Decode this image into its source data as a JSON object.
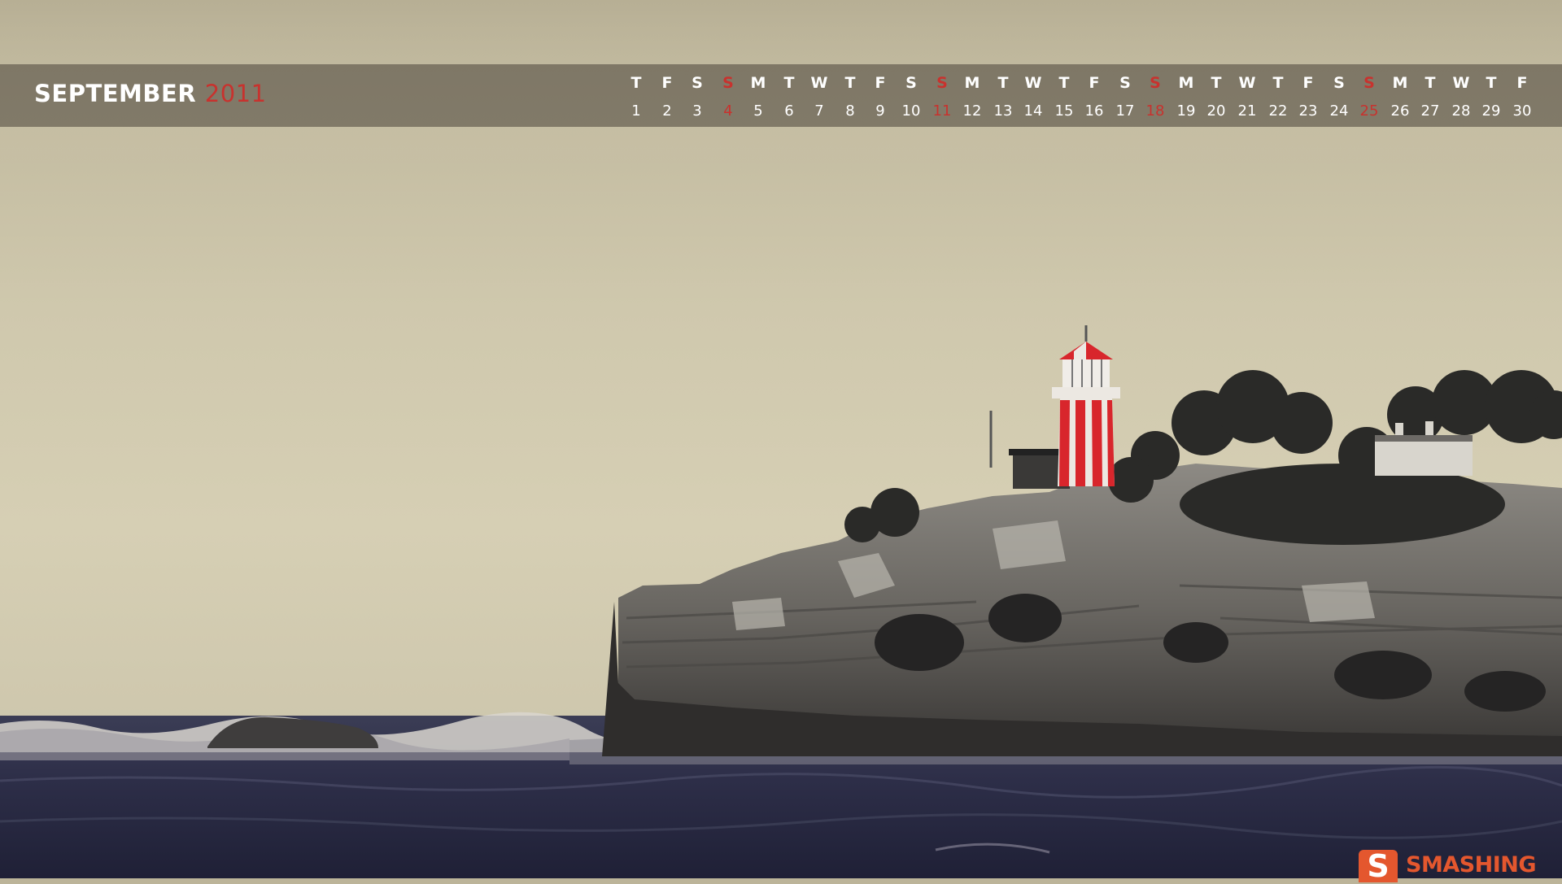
{
  "calendar": {
    "month": "SEPTEMBER",
    "year": "2011",
    "days": [
      {
        "dow": "T",
        "num": "1",
        "sunday": false
      },
      {
        "dow": "F",
        "num": "2",
        "sunday": false
      },
      {
        "dow": "S",
        "num": "3",
        "sunday": false
      },
      {
        "dow": "S",
        "num": "4",
        "sunday": true
      },
      {
        "dow": "M",
        "num": "5",
        "sunday": false
      },
      {
        "dow": "T",
        "num": "6",
        "sunday": false
      },
      {
        "dow": "W",
        "num": "7",
        "sunday": false
      },
      {
        "dow": "T",
        "num": "8",
        "sunday": false
      },
      {
        "dow": "F",
        "num": "9",
        "sunday": false
      },
      {
        "dow": "S",
        "num": "10",
        "sunday": false
      },
      {
        "dow": "S",
        "num": "11",
        "sunday": true
      },
      {
        "dow": "M",
        "num": "12",
        "sunday": false
      },
      {
        "dow": "T",
        "num": "13",
        "sunday": false
      },
      {
        "dow": "W",
        "num": "14",
        "sunday": false
      },
      {
        "dow": "T",
        "num": "15",
        "sunday": false
      },
      {
        "dow": "F",
        "num": "16",
        "sunday": false
      },
      {
        "dow": "S",
        "num": "17",
        "sunday": false
      },
      {
        "dow": "S",
        "num": "18",
        "sunday": true
      },
      {
        "dow": "M",
        "num": "19",
        "sunday": false
      },
      {
        "dow": "T",
        "num": "20",
        "sunday": false
      },
      {
        "dow": "W",
        "num": "21",
        "sunday": false
      },
      {
        "dow": "T",
        "num": "22",
        "sunday": false
      },
      {
        "dow": "F",
        "num": "23",
        "sunday": false
      },
      {
        "dow": "S",
        "num": "24",
        "sunday": false
      },
      {
        "dow": "S",
        "num": "25",
        "sunday": true
      },
      {
        "dow": "M",
        "num": "26",
        "sunday": false
      },
      {
        "dow": "T",
        "num": "27",
        "sunday": false
      },
      {
        "dow": "W",
        "num": "28",
        "sunday": false
      },
      {
        "dow": "T",
        "num": "29",
        "sunday": false
      },
      {
        "dow": "F",
        "num": "30",
        "sunday": false
      }
    ]
  },
  "logo": {
    "letter": "S",
    "text": "SMASHING"
  },
  "colors": {
    "accent_red": "#c8322e",
    "logo_orange": "#e4572e",
    "sky": "#d6cfb4",
    "sea": "#2b2c45",
    "lighthouse_red": "#d8262c"
  },
  "scene": {
    "subject": "lighthouse-on-cliff",
    "icons": [
      "lighthouse-icon",
      "cliff-icon",
      "sea-icon",
      "trees-icon",
      "house-icon"
    ]
  }
}
